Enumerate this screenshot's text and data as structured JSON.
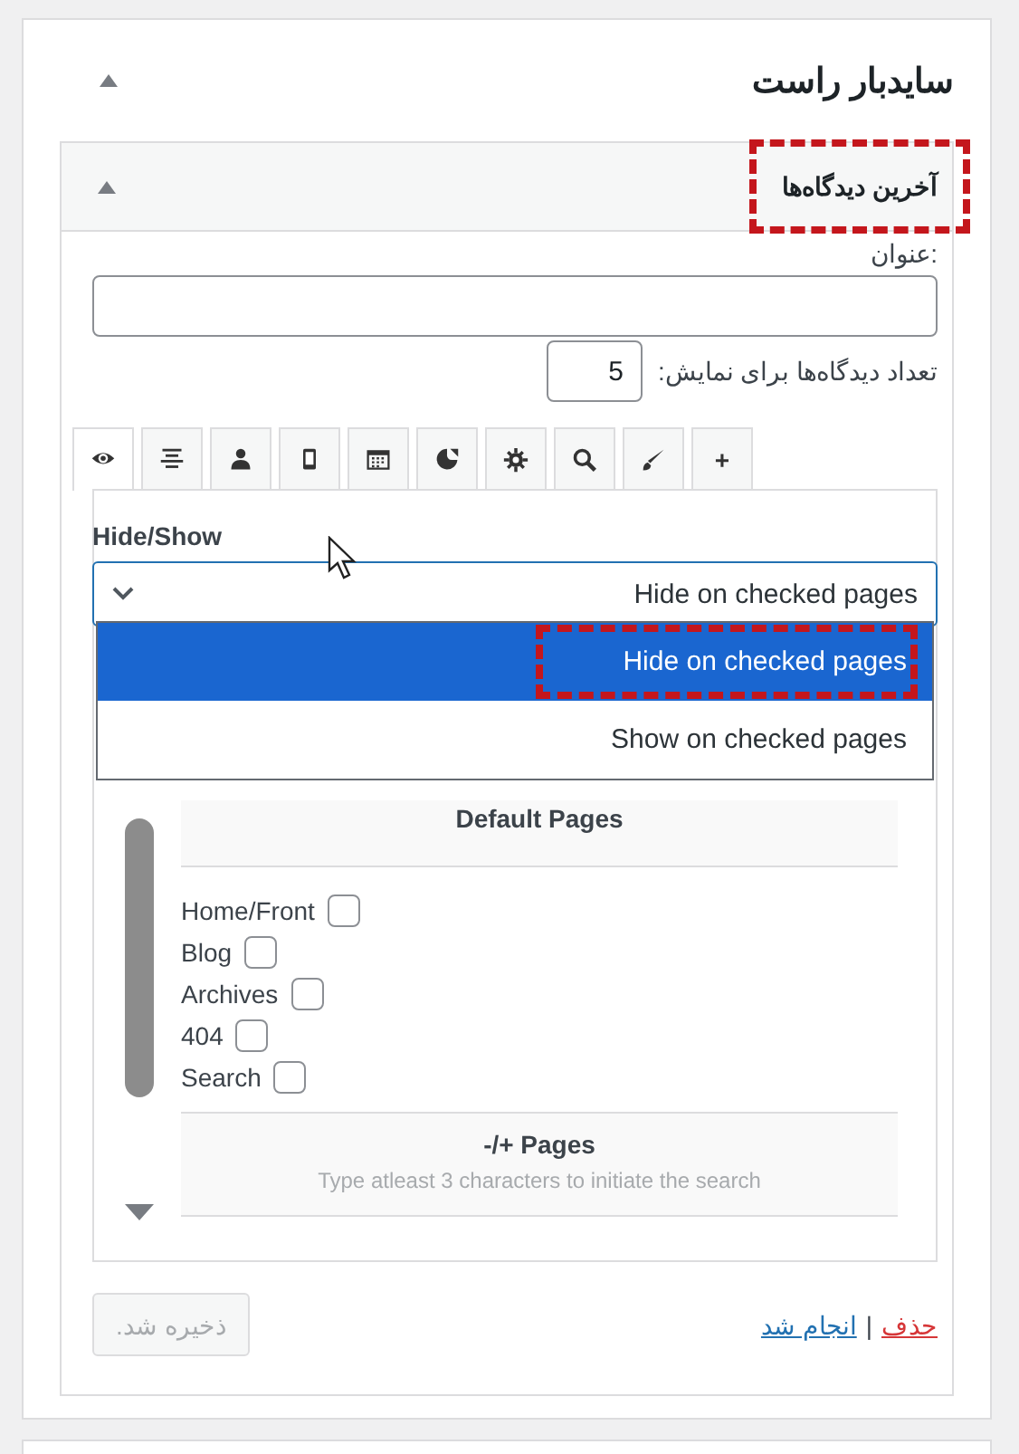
{
  "sidebar": {
    "title": "سایدبار راست",
    "expanded": true
  },
  "widget": {
    "title": "آخرین دیدگاه‌ها",
    "highlighted": true,
    "expanded": true,
    "title_field": {
      "label": "عنوان:"
    },
    "count_field": {
      "label": "تعداد دیدگاه‌ها برای نمایش:",
      "value": "5"
    },
    "tabs": [
      {
        "selected": true
      },
      {
        "selected": false
      },
      {
        "selected": false
      },
      {
        "selected": false
      },
      {
        "selected": false
      },
      {
        "selected": false
      },
      {
        "selected": false
      },
      {
        "selected": false
      },
      {
        "selected": false
      },
      {
        "label": "+",
        "selected": false
      }
    ],
    "visibility": {
      "label": "Hide/Show",
      "value": "Hide on checked pages",
      "options": [
        {
          "label": "Hide on checked pages",
          "selected": true,
          "highlighted": true
        },
        {
          "label": "Show on checked pages",
          "selected": false,
          "highlighted": false
        }
      ]
    },
    "default_pages": {
      "title": "Default Pages",
      "items": [
        {
          "label": "Home/Front",
          "checked": false
        },
        {
          "label": "Blog",
          "checked": false
        },
        {
          "label": "Archives",
          "checked": false
        },
        {
          "label": "404",
          "checked": false
        },
        {
          "label": "Search",
          "checked": false
        }
      ]
    },
    "pages_search": {
      "title": "-/+ Pages",
      "hint": "Type atleast 3 characters to initiate the search"
    },
    "save_button": {
      "label": "ذخیره شد.",
      "disabled": true
    },
    "links": [
      {
        "label": "حذف",
        "kind": "delete"
      },
      {
        "label": "انجام شد",
        "kind": "done"
      }
    ],
    "separator": "|"
  }
}
